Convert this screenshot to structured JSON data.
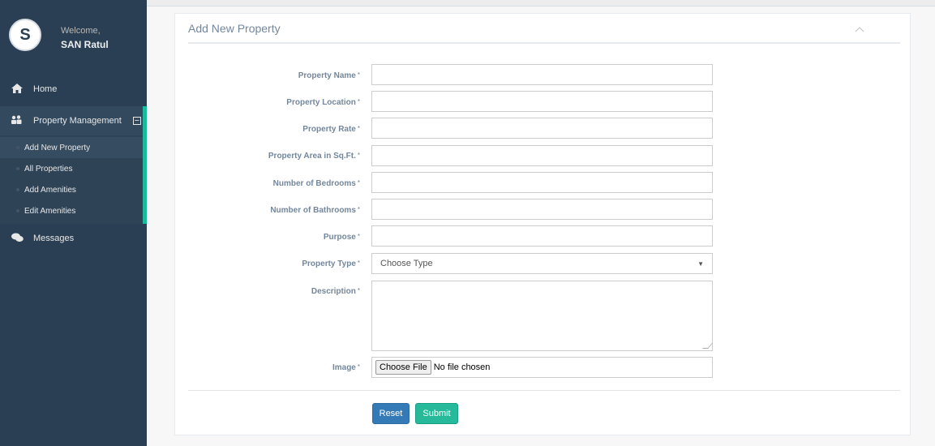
{
  "user": {
    "avatar_letter": "S",
    "welcome": "Welcome,",
    "name": "SAN Ratul"
  },
  "sidebar": {
    "home": "Home",
    "property_management": "Property Management",
    "toggle_symbol": "−",
    "submenu": [
      "Add New Property",
      "All Properties",
      "Add Amenities",
      "Edit Amenities"
    ],
    "messages": "Messages"
  },
  "panel": {
    "title": "Add New Property"
  },
  "form": {
    "required_mark": "*",
    "fields": [
      {
        "label": "Property Name",
        "value": ""
      },
      {
        "label": "Property Location",
        "value": ""
      },
      {
        "label": "Property Rate",
        "value": ""
      },
      {
        "label": "Property Area in Sq.Ft.",
        "value": ""
      },
      {
        "label": "Number of Bedrooms",
        "value": ""
      },
      {
        "label": "Number of Bathrooms",
        "value": ""
      },
      {
        "label": "Purpose",
        "value": ""
      }
    ],
    "type_label": "Property Type",
    "type_selected": "Choose Type",
    "description_label": "Description",
    "image_label": "Image",
    "file_button": "Choose File",
    "file_status": "No file chosen"
  },
  "buttons": {
    "reset": "Reset",
    "submit": "Submit"
  },
  "colors": {
    "sidebar_bg": "#2a3f54",
    "accent_green": "#1abb9c",
    "reset_blue": "#337ab7",
    "submit_green": "#26b99a"
  }
}
